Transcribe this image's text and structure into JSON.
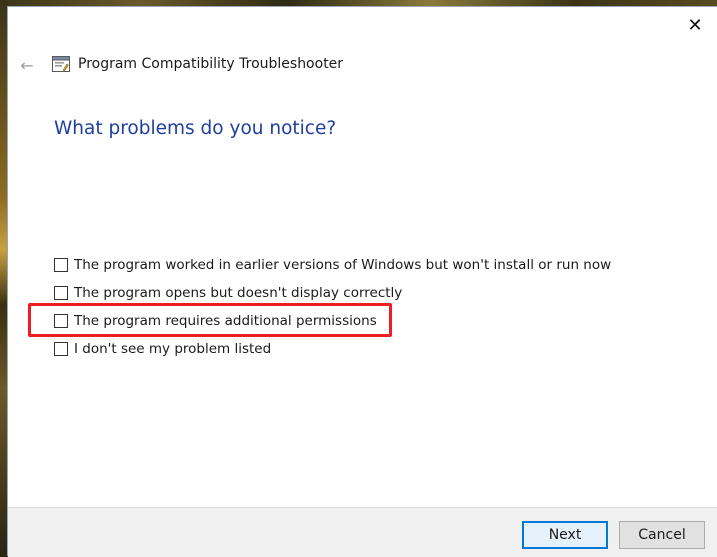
{
  "window": {
    "title": "Program Compatibility Troubleshooter",
    "close_glyph": "✕",
    "back_glyph": "←"
  },
  "page": {
    "heading": "What problems do you notice?"
  },
  "options": [
    {
      "label": "The program worked in earlier versions of Windows but won't install or run now",
      "checked": false
    },
    {
      "label": "The program opens but doesn't display correctly",
      "checked": false
    },
    {
      "label": "The program requires additional permissions",
      "checked": false,
      "highlighted": true
    },
    {
      "label": "I don't see my problem listed",
      "checked": false
    }
  ],
  "footer": {
    "next_label": "Next",
    "cancel_label": "Cancel"
  },
  "colors": {
    "heading": "#1f3fa0",
    "highlight": "#ee1c25",
    "default_button_border": "#0078d7"
  },
  "icons": {
    "app": "troubleshooter-window-icon",
    "back": "back-arrow-icon",
    "close": "close-icon"
  }
}
